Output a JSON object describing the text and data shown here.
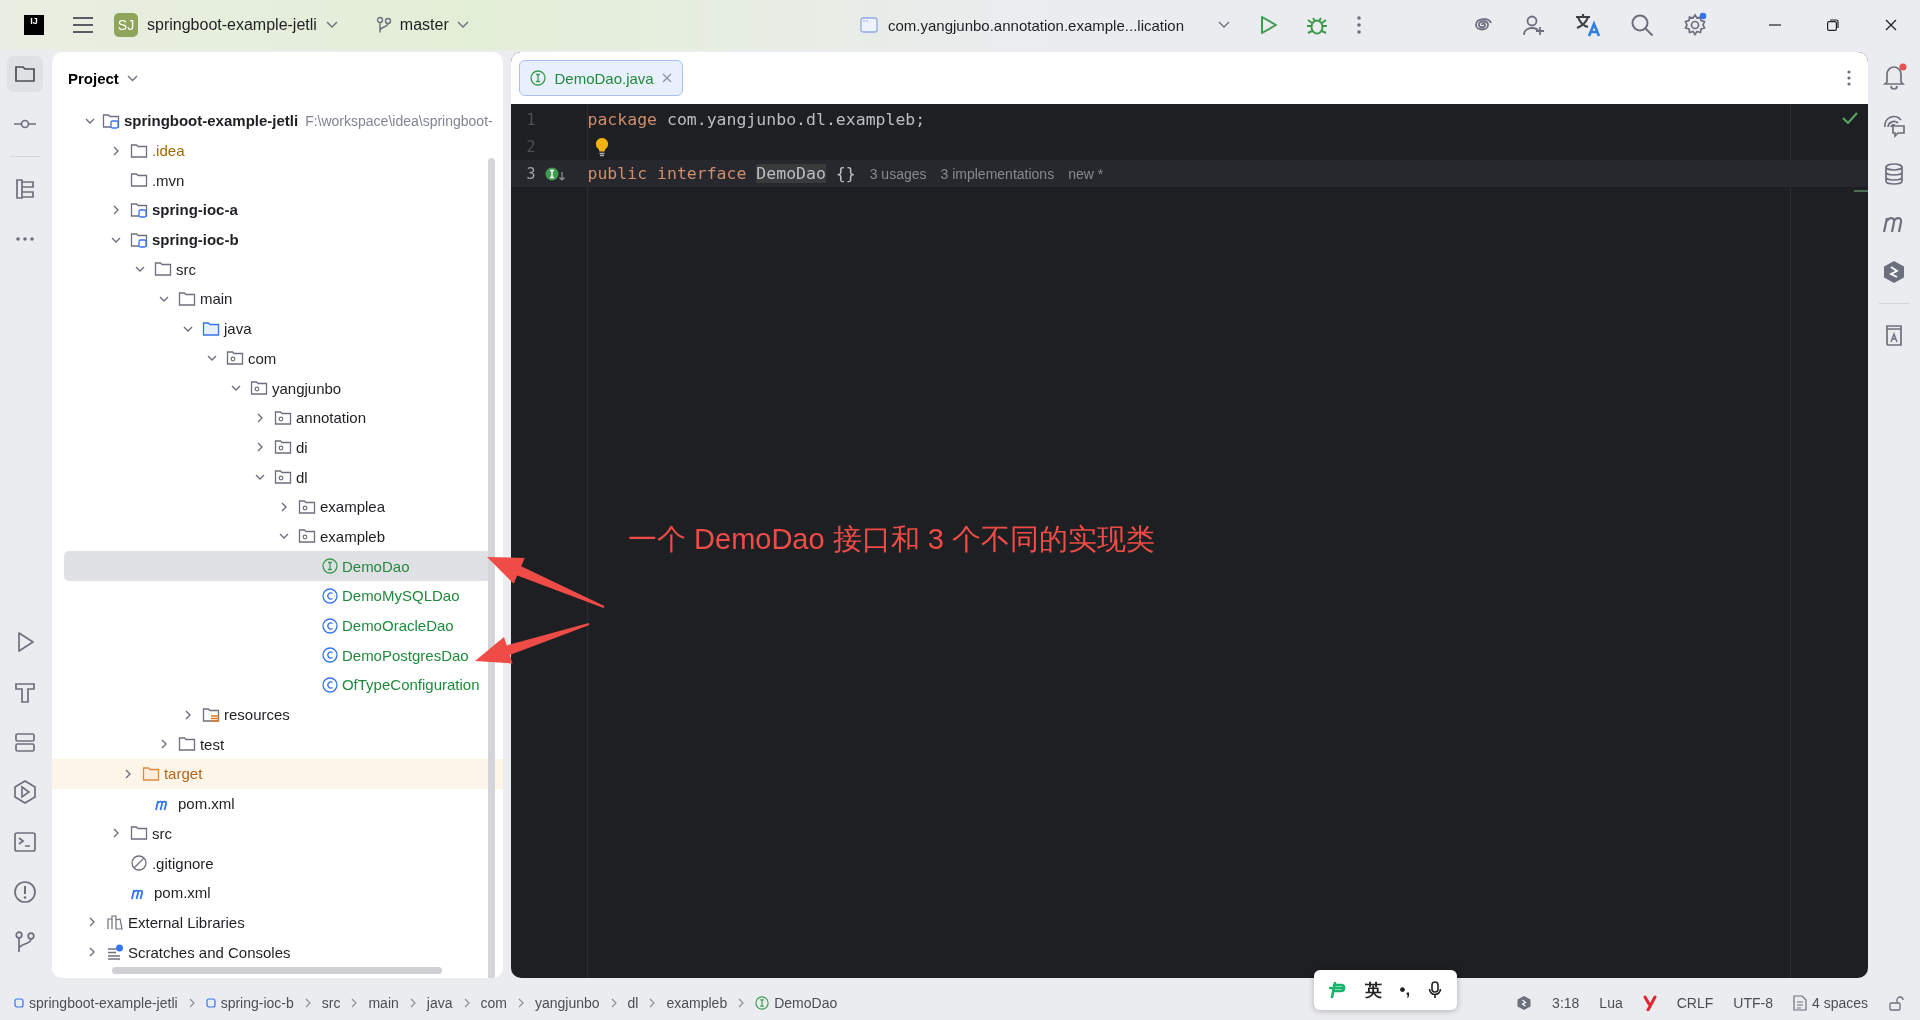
{
  "toolbar": {
    "logo": "IJ",
    "project_badge": "SJ",
    "project": "springboot-example-jetli",
    "branch": "master",
    "run_config": "com.yangjunbo.annotation.example...lication"
  },
  "project_panel": {
    "title": "Project",
    "tree": [
      {
        "label": "springboot-example-jetli",
        "kind": "module",
        "path": "F:\\workspace\\idea\\springboot-",
        "selected": false,
        "expanded": true,
        "children": [
          {
            "label": ".idea",
            "kind": "folder",
            "color": "#9e6a00",
            "selected": false,
            "expanded": false
          },
          {
            "label": ".mvn",
            "kind": "folder",
            "selected": false
          },
          {
            "label": "spring-ioc-a",
            "kind": "module",
            "selected": false,
            "expanded": false
          },
          {
            "label": "spring-ioc-b",
            "kind": "module",
            "selected": false,
            "expanded": true,
            "children": [
              {
                "label": "src",
                "kind": "folder",
                "selected": false,
                "expanded": true,
                "children": [
                  {
                    "label": "main",
                    "kind": "folder",
                    "selected": false,
                    "expanded": true,
                    "children": [
                      {
                        "label": "java",
                        "kind": "source",
                        "selected": false,
                        "expanded": true,
                        "children": [
                          {
                            "label": "com",
                            "kind": "package",
                            "selected": false,
                            "expanded": true,
                            "children": [
                              {
                                "label": "yangjunbo",
                                "kind": "package",
                                "selected": false,
                                "expanded": true,
                                "children": [
                                  {
                                    "label": "annotation",
                                    "kind": "package",
                                    "selected": false,
                                    "expanded": false
                                  },
                                  {
                                    "label": "di",
                                    "kind": "package",
                                    "selected": false,
                                    "expanded": false
                                  },
                                  {
                                    "label": "dl",
                                    "kind": "package",
                                    "selected": false,
                                    "expanded": true,
                                    "children": [
                                      {
                                        "label": "examplea",
                                        "kind": "package",
                                        "selected": false,
                                        "expanded": false
                                      },
                                      {
                                        "label": "exampleb",
                                        "kind": "package",
                                        "selected": false,
                                        "expanded": true,
                                        "children": [
                                          {
                                            "label": "DemoDao",
                                            "kind": "interface",
                                            "color": "#208a3c",
                                            "selected": true
                                          },
                                          {
                                            "label": "DemoMySQLDao",
                                            "kind": "class",
                                            "color": "#208a3c",
                                            "selected": false
                                          },
                                          {
                                            "label": "DemoOracleDao",
                                            "kind": "class",
                                            "color": "#208a3c",
                                            "selected": false
                                          },
                                          {
                                            "label": "DemoPostgresDao",
                                            "kind": "class",
                                            "color": "#208a3c",
                                            "selected": false
                                          },
                                          {
                                            "label": "OfTypeConfiguration",
                                            "kind": "class",
                                            "color": "#208a3c",
                                            "selected": false
                                          }
                                        ]
                                      }
                                    ]
                                  }
                                ]
                              }
                            ]
                          }
                        ]
                      },
                      {
                        "label": "resources",
                        "kind": "resources",
                        "selected": false,
                        "expanded": false
                      }
                    ]
                  },
                  {
                    "label": "test",
                    "kind": "folder",
                    "selected": false,
                    "expanded": false
                  }
                ]
              },
              {
                "label": "target",
                "kind": "excluded",
                "color": "#b5651d",
                "selected": false,
                "expanded": false
              },
              {
                "label": "pom.xml",
                "kind": "maven",
                "selected": false
              }
            ]
          },
          {
            "label": "src",
            "kind": "folder",
            "selected": false,
            "expanded": false
          },
          {
            "label": ".gitignore",
            "kind": "ignore",
            "selected": false
          },
          {
            "label": "pom.xml",
            "kind": "maven",
            "selected": false
          }
        ]
      },
      {
        "label": "External Libraries",
        "kind": "library",
        "selected": false,
        "expanded": false
      },
      {
        "label": "Scratches and Consoles",
        "kind": "scratches",
        "selected": false,
        "expanded": false
      }
    ]
  },
  "editor": {
    "tabs": [
      {
        "label": "DemoDao.java",
        "kind": "interface",
        "selected": true
      }
    ],
    "lines": [
      {
        "number": "1",
        "current": false,
        "tokens": [
          {
            "text": "package",
            "kind": "keyword"
          },
          {
            "text": "com.yangjunbo.dl.exampleb;",
            "kind": "plain"
          }
        ]
      },
      {
        "number": "2",
        "current": false,
        "bulb": true
      },
      {
        "number": "3",
        "current": true,
        "implemented": true,
        "tokens": [
          {
            "text": "public",
            "kind": "keyword"
          },
          {
            "text": "interface",
            "kind": "keyword"
          },
          {
            "text": "DemoDao",
            "kind": "highlight"
          },
          {
            "text": "{}",
            "kind": "plain"
          }
        ],
        "hints": [
          "3 usages",
          "3 implementations",
          "new *"
        ]
      }
    ]
  },
  "annotation": {
    "text": "一个 DemoDao 接口和 3 个不同的实现类"
  },
  "status_bar": {
    "breadcrumbs": [
      {
        "text": "springboot-example-jetli",
        "kind": "module"
      },
      {
        "text": "spring-ioc-b",
        "kind": "module"
      },
      {
        "text": "src",
        "kind": "plain"
      },
      {
        "text": "main",
        "kind": "plain"
      },
      {
        "text": "java",
        "kind": "plain"
      },
      {
        "text": "com",
        "kind": "plain"
      },
      {
        "text": "yangjunbo",
        "kind": "plain"
      },
      {
        "text": "dl",
        "kind": "plain"
      },
      {
        "text": "exampleb",
        "kind": "plain"
      },
      {
        "text": "DemoDao",
        "kind": "interface"
      }
    ],
    "position": "3:18",
    "language": "Lua",
    "line_separator": "CRLF",
    "encoding": "UTF-8",
    "indent": "4 spaces"
  },
  "input_method": {
    "language": "英",
    "punctuation": "•,"
  }
}
